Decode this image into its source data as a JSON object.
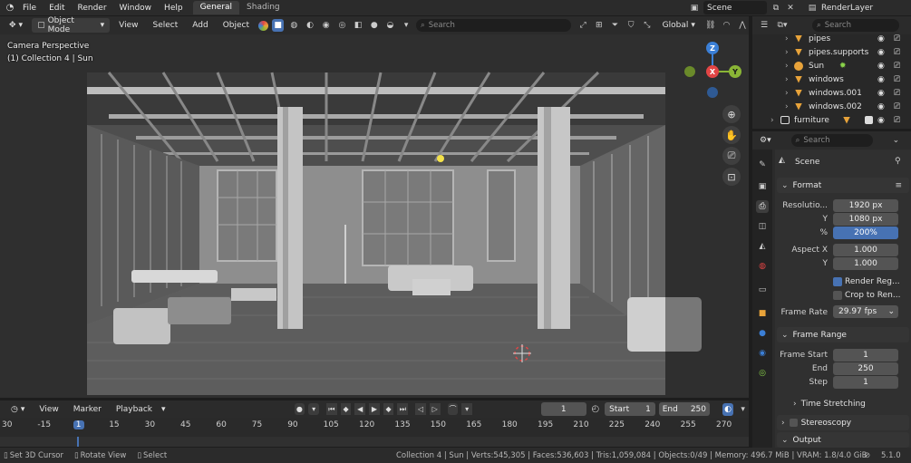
{
  "menu": {
    "file": "File",
    "edit": "Edit",
    "render": "Render",
    "window": "Window",
    "help": "Help"
  },
  "workspaces": {
    "general": "General",
    "shading": "Shading"
  },
  "top_right": {
    "scene": "Scene",
    "render_layer": "RenderLayer"
  },
  "viewport_header": {
    "mode": "Object Mode",
    "view": "View",
    "select": "Select",
    "add": "Add",
    "object": "Object",
    "search_placeholder": "Search",
    "orientation": "Global"
  },
  "viewport": {
    "camera_label": "Camera Perspective",
    "collection_label": "(1) Collection 4 | Sun"
  },
  "gizmo": {
    "z": "Z",
    "x": "X",
    "y": "Y"
  },
  "timeline": {
    "view": "View",
    "marker": "Marker",
    "playback": "Playback",
    "current_frame": "1",
    "start_label": "Start",
    "start": "1",
    "end_label": "End",
    "end": "250",
    "ticks": [
      "30",
      "-15",
      "1",
      "15",
      "30",
      "45",
      "60",
      "75",
      "90",
      "105",
      "120",
      "135",
      "150",
      "165",
      "180",
      "195",
      "210",
      "225",
      "240",
      "255",
      "270"
    ]
  },
  "status": {
    "set_cursor": "Set 3D Cursor",
    "rotate": "Rotate View",
    "select": "Select",
    "stats": "Collection 4 | Sun | Verts:545,305 | Faces:536,603 | Tris:1,059,084 | Objects:0/49 | Memory: 496.7 MiB | VRAM: 1.8/4.0 GiB",
    "version": "5.1.0"
  },
  "outliner": {
    "search_placeholder": "Search",
    "items": [
      {
        "name": "pipes",
        "icon": "mesh-triangle-icon"
      },
      {
        "name": "pipes.supports",
        "icon": "mesh-triangle-icon"
      },
      {
        "name": "Sun",
        "icon": "light-icon"
      },
      {
        "name": "windows",
        "icon": "mesh-triangle-icon"
      },
      {
        "name": "windows.001",
        "icon": "mesh-triangle-icon"
      },
      {
        "name": "windows.002",
        "icon": "mesh-triangle-icon"
      },
      {
        "name": "furniture",
        "icon": "collection-icon"
      }
    ]
  },
  "properties": {
    "search_placeholder": "Search",
    "context": "Scene",
    "format": {
      "title": "Format",
      "resolution_label": "Resolutio...",
      "res_x": "1920 px",
      "y_label": "Y",
      "res_y": "1080 px",
      "pct_label": "%",
      "res_pct": "200%",
      "aspect_label": "Aspect X",
      "aspect_x": "1.000",
      "aspect_y_label": "Y",
      "aspect_y": "1.000",
      "render_region": "Render Reg...",
      "crop": "Crop to Ren...",
      "frame_rate_label": "Frame Rate",
      "frame_rate": "29.97 fps"
    },
    "frame_range": {
      "title": "Frame Range",
      "start_label": "Frame Start",
      "start": "1",
      "end_label": "End",
      "end": "250",
      "step_label": "Step",
      "step": "1"
    },
    "time_stretching": "Time Stretching",
    "stereoscopy": "Stereoscopy",
    "output": "Output"
  },
  "colors": {
    "accent": "#4772b3",
    "gizmo_x": "#e24545",
    "gizmo_y": "#8ab536",
    "gizmo_z": "#3b7fd6",
    "object": "#e8a33a"
  }
}
